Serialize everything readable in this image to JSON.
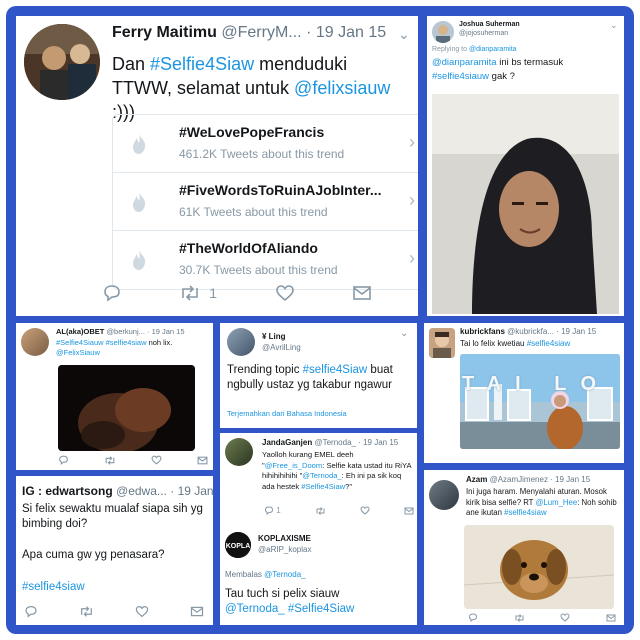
{
  "tweet1": {
    "name": "Ferry Maitimu",
    "handle": "@FerryM...",
    "date": "· 19 Jan 15",
    "text_pre": "Dan ",
    "hashtag": "#Selfie4Siaw",
    "text_mid": " menduduki TTWW, selamat untuk ",
    "mention": "@felixsiauw",
    "text_post": " :)))",
    "trends": [
      {
        "name": "#WeLovePopeFrancis",
        "count": "461.2K Tweets about this trend"
      },
      {
        "name": "#FiveWordsToRuinAJobInter...",
        "count": "61K Tweets about this trend"
      },
      {
        "name": "#TheWorldOfAliando",
        "count": "30.7K Tweets about this trend"
      }
    ],
    "retweet_count": "1"
  },
  "tweet2": {
    "name": "Joshua Suherman",
    "handle": "@jojosuherman",
    "reply_label": "Replying to ",
    "reply_to": "@dianparamita",
    "mention": "@dianparamita",
    "text": " ini bs termasuk",
    "hashtag": "#selfie4siauw",
    "text2": " gak ?"
  },
  "tweet3": {
    "name": "AL(aka)OBET",
    "handle": "@berkunj...",
    "date": "· 19 Jan 15",
    "hashtag1": "#Selfie4Siauw",
    "hashtag2": "#selfie4siaw",
    "text": " noh lix.",
    "mention": "@FelixSiauw"
  },
  "tweet4": {
    "name": "¥ Ling",
    "handle": "@AvrilLing",
    "text_pre": "Trending topic ",
    "hashtag": "#selfie4Siaw",
    "text_post": " buat ngbully ustaz yg takabur ngawur",
    "translate": "Terjemahkan dari Bahasa Indonesia"
  },
  "tweet5": {
    "name": "kubrickfans",
    "handle": "@kubrickfa...",
    "date": "· 19 Jan 15",
    "text": "Tai lo felix kwetiau ",
    "hashtag": "#selfie4siaw",
    "sign_text": "TAI LO"
  },
  "tweet6": {
    "name": "IG : edwartsong",
    "handle": "@edwa...",
    "date": "· 19 Jan 15",
    "line1": "Si felix sewaktu mualaf siapa sih yg bimbing doi?",
    "line2": "Apa cuma gw yg penasara?",
    "hashtag": "#selfie4siaw"
  },
  "tweet7": {
    "name": "JandaGanjen",
    "handle": "@Ternoda_",
    "date": "· 19 Jan 15",
    "text1": "Yaolloh kurang EMEL deeh \"",
    "m1": "@Free_is_Doom",
    "text2": ": Selfie kata ustad itu RiYA hihihihihihi \"",
    "m2": "@Ternoda_",
    "text3": ": Eh ini pa sik koq ada hestek ",
    "hashtag": "#Selfie4Siaw",
    "text4": "?\"",
    "reply_count": "1",
    "reply_name": "KOPLAXISME",
    "reply_handle": "@aRIP_koplax",
    "reply_label": "Membalas ",
    "reply_to": "@Ternoda_",
    "reply_text": "Tau tuch si pelix siauw",
    "reply_mention": "@Ternoda_",
    "reply_hashtag": "#Selfie4Siaw",
    "avatar_label": "KOPLA"
  },
  "tweet8": {
    "name": "Azam",
    "handle": "@AzamJimenez",
    "date": "· 19 Jan 15",
    "text1": "Ini juga haram. Menyalahi aturan. Mosok kirik bisa selfie? RT ",
    "mention": "@Lum_Hee",
    "text2": ": Noh sohib ane ikutan ",
    "hashtag": "#selfie4siaw"
  },
  "colors": {
    "frame": "#2f55c9",
    "link": "#1b95e0",
    "muted": "#657786"
  }
}
